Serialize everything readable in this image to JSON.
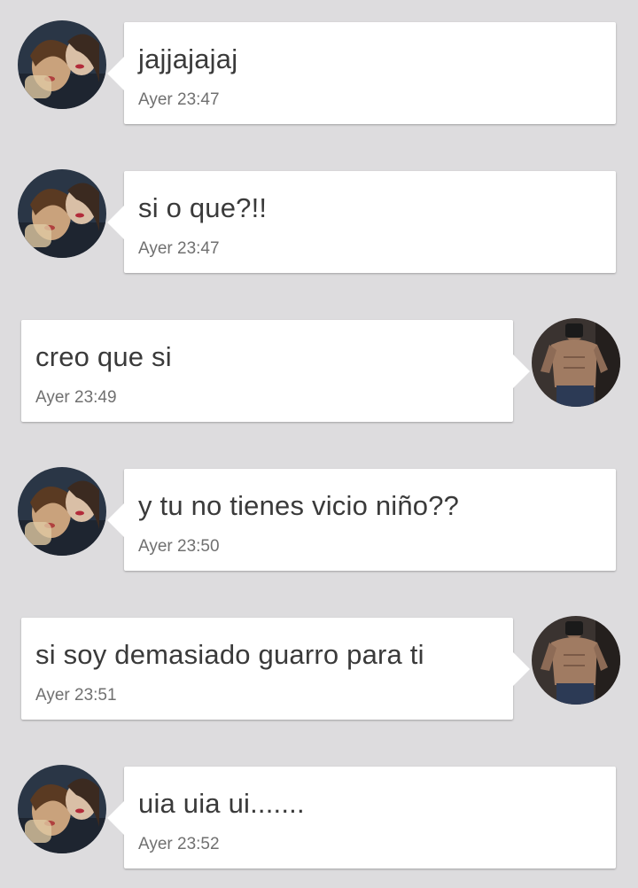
{
  "messages": [
    {
      "direction": "in",
      "avatar": "women-selfie-avatar",
      "text": "jajjajajaj",
      "time": "Ayer 23:47"
    },
    {
      "direction": "in",
      "avatar": "women-selfie-avatar",
      "text": "si o que?!!",
      "time": "Ayer 23:47"
    },
    {
      "direction": "out",
      "avatar": "man-mirror-selfie-avatar",
      "text": "creo que si",
      "time": "Ayer 23:49"
    },
    {
      "direction": "in",
      "avatar": "women-selfie-avatar",
      "text": "y tu no tienes vicio niño??",
      "time": "Ayer 23:50"
    },
    {
      "direction": "out",
      "avatar": "man-mirror-selfie-avatar",
      "text": "si soy demasiado guarro para ti",
      "time": "Ayer 23:51"
    },
    {
      "direction": "in",
      "avatar": "women-selfie-avatar",
      "text": "uia uia ui.......",
      "time": "Ayer 23:52"
    }
  ],
  "colors": {
    "background": "#dddcde",
    "bubble": "#ffffff",
    "message_text": "#3a3a3a",
    "time_text": "#707070"
  }
}
